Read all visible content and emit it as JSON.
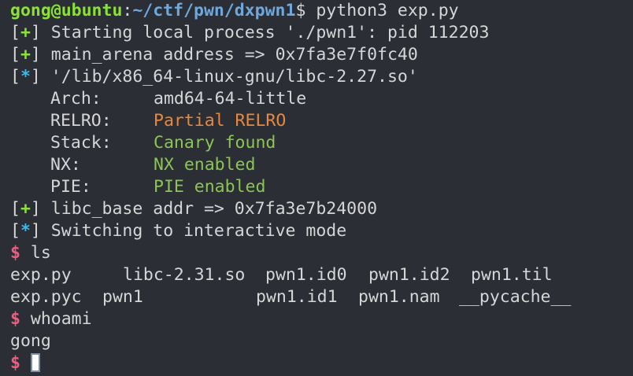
{
  "prompt": {
    "user_host": "gong@ubuntu",
    "colon": ":",
    "path": "~/ctf/pwn/dxpwn1",
    "dollar": "$",
    "command": "python3 exp.py"
  },
  "log": {
    "line1": {
      "open": "[",
      "mark": "+",
      "close": "]",
      "text": " Starting local process './pwn1': pid 112203"
    },
    "line2": {
      "open": "[",
      "mark": "+",
      "close": "]",
      "text": " main_arena address => 0x7fa3e7f0fc40"
    },
    "line3": {
      "open": "[",
      "mark": "*",
      "close": "]",
      "text": " '/lib/x86_64-linux-gnu/libc-2.27.so'"
    },
    "checksec": [
      {
        "key": "Arch:",
        "value": "amd64-64-little",
        "color": "#d6d6d6"
      },
      {
        "key": "RELRO:",
        "value": "Partial RELRO",
        "color": "#e8883a"
      },
      {
        "key": "Stack:",
        "value": "Canary found",
        "color": "#8ac651"
      },
      {
        "key": "NX:",
        "value": "NX enabled",
        "color": "#8ac651"
      },
      {
        "key": "PIE:",
        "value": "PIE enabled",
        "color": "#8ac651"
      }
    ],
    "line4": {
      "open": "[",
      "mark": "+",
      "close": "]",
      "text": " libc_base addr => 0x7fa3e7b24000"
    },
    "line5": {
      "open": "[",
      "mark": "*",
      "close": "]",
      "text": " Switching to interactive mode"
    }
  },
  "shell": {
    "prompt": "$",
    "cmd_ls": "ls",
    "ls_row1": [
      "exp.py",
      "libc-2.31.so",
      "pwn1.id0",
      "pwn1.id2",
      "pwn1.til"
    ],
    "ls_row2": [
      "exp.pyc",
      "pwn1",
      "pwn1.id1",
      "pwn1.nam",
      "__pycache__"
    ],
    "cmd_whoami": "whoami",
    "whoami_output": "gong"
  },
  "colors": {
    "background": "#2b2e35",
    "green": "#8ae234",
    "blue": "#6fa8dc",
    "cyan": "#44b6e8",
    "orange": "#e8883a",
    "pink": "#f05c7e"
  }
}
